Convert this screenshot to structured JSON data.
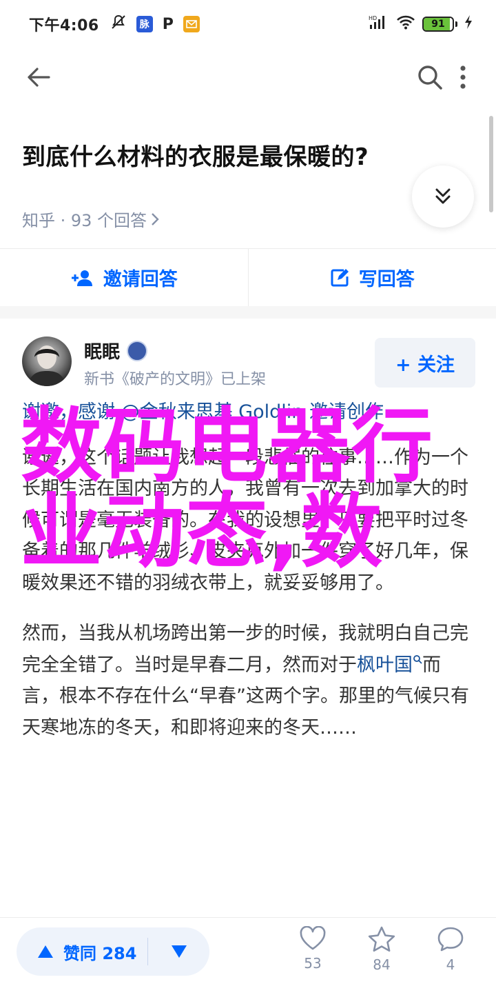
{
  "status_bar": {
    "time": "下午4:06",
    "box1_text": "脉",
    "box2_text": "P",
    "battery": {
      "level": 91,
      "label": "91"
    }
  },
  "question": {
    "title": "到底什么材料的衣服是最保暖的?",
    "meta": "知乎 · 93 个回答"
  },
  "actions": {
    "invite_label": "邀请回答",
    "write_label": "写回答"
  },
  "author": {
    "name": "眠眠",
    "subtitle": "新书《破产的文明》已上架",
    "badge": "",
    "follow_label": "+ 关注"
  },
  "article": {
    "line_invite": "谢邀，感谢 @金秋来思基 Goldlin 邀请创作",
    "para1": "谢邀，这个话题让我想起一段悲催的往事……作为一个长期生活在国内南方的人，我曾有一次去到加拿大的时候可谓是毫无装备的。在我的设想里，只要把平时过冬备着的那几件羊绒衫、皮夹克外加一件穿了好几年，保暖效果还不错的羽绒衣带上，就妥妥够用了。",
    "para2_before": "然而，当我从机场跨出第一步的时候，我就明白自己完完全全错了。当时是早春二月，然而对于",
    "para2_link": "枫叶国",
    "para2_after": "而言，根本不存在什么“早春”这两个字。那里的气候只有天寒地冻的冬天，和即将迎来的冬天……"
  },
  "overlay": {
    "text": "数码电器行业动态,数"
  },
  "bottom_bar": {
    "upvote_label": "赞同 284",
    "likes": "53",
    "favorites": "84",
    "comments": "4"
  },
  "colors": {
    "accent": "#0066ff",
    "overlay": "#f018f5",
    "meta_gray": "#8590a6",
    "link": "#175199"
  }
}
